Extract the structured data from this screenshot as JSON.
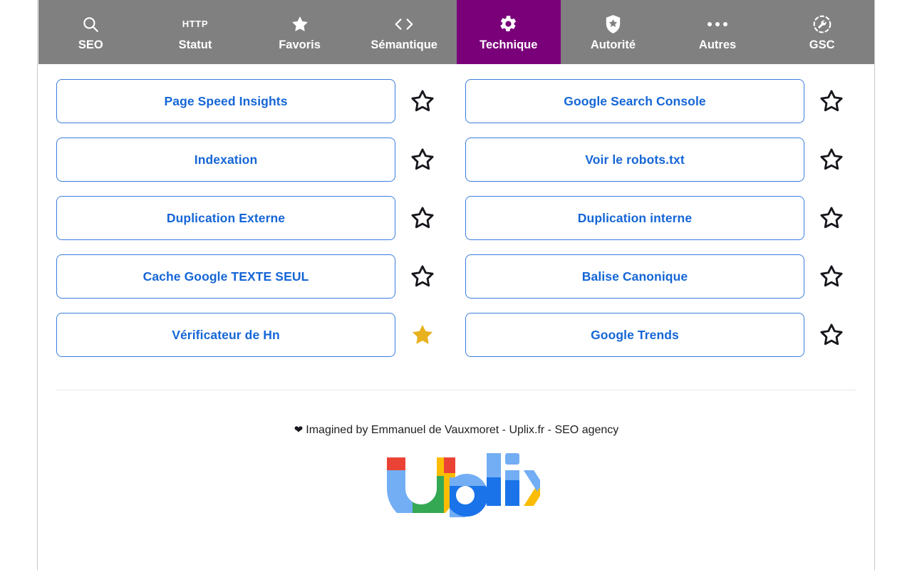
{
  "nav": {
    "tabs": [
      {
        "label": "SEO",
        "icon": "search-icon",
        "active": false
      },
      {
        "label": "Statut",
        "icon": "http-icon",
        "active": false
      },
      {
        "label": "Favoris",
        "icon": "star-filled-icon",
        "active": false
      },
      {
        "label": "Sémantique",
        "icon": "code-icon",
        "active": false
      },
      {
        "label": "Technique",
        "icon": "gear-icon",
        "active": true
      },
      {
        "label": "Autorité",
        "icon": "shield-star-icon",
        "active": false
      },
      {
        "label": "Autres",
        "icon": "ellipsis-icon",
        "active": false
      },
      {
        "label": "GSC",
        "icon": "wrench-gauge-icon",
        "active": false
      }
    ],
    "active_tab": "Technique",
    "bg_color": "#808080",
    "active_color": "#7a007a",
    "text_color": "#ffffff"
  },
  "main": {
    "columns": [
      {
        "items": [
          {
            "label": "Page Speed Insights",
            "favorited": false
          },
          {
            "label": "Indexation",
            "favorited": false
          },
          {
            "label": "Duplication Externe",
            "favorited": false
          },
          {
            "label": "Cache Google TEXTE SEUL",
            "favorited": false
          },
          {
            "label": "Vérificateur de Hn",
            "favorited": true
          }
        ]
      },
      {
        "items": [
          {
            "label": "Google Search Console",
            "favorited": false
          },
          {
            "label": "Voir le robots.txt",
            "favorited": false
          },
          {
            "label": "Duplication interne",
            "favorited": false
          },
          {
            "label": "Balise Canonique",
            "favorited": false
          },
          {
            "label": "Google Trends",
            "favorited": false
          }
        ]
      }
    ],
    "button_border_color": "#3b7ddd",
    "button_text_color": "#1566d6",
    "star_empty_color": "#16161d",
    "star_filled_color": "#e8b21e"
  },
  "footer": {
    "heart": "❤",
    "credits": "Imagined by Emmanuel de Vauxmoret - Uplix.fr - SEO agency",
    "logo_alt": "Uplix",
    "logo_colors": {
      "red": "#ea4335",
      "yellow": "#fbbc04",
      "green": "#34a853",
      "blue": "#1a73e8",
      "light_blue": "#73aef4"
    }
  }
}
